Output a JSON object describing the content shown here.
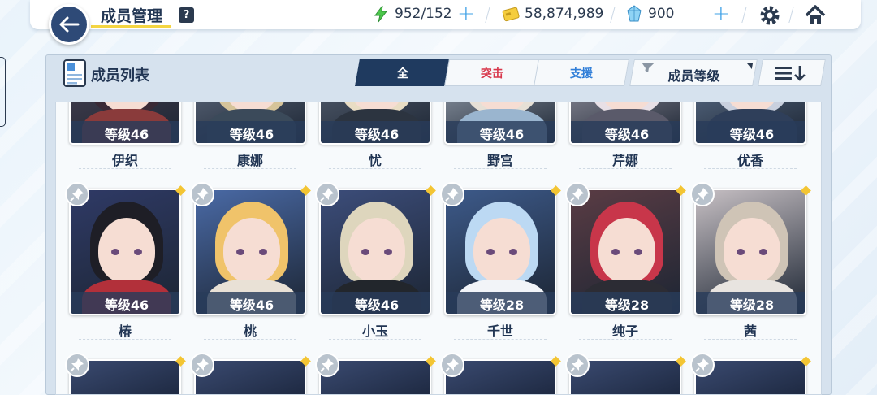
{
  "header": {
    "title": "成员管理",
    "help_label": "?",
    "resources": [
      {
        "icon": "lightning-icon",
        "value": "952/152"
      },
      {
        "icon": "credit-card-icon",
        "value": "58,874,989"
      },
      {
        "icon": "crystal-icon",
        "value": "900"
      }
    ]
  },
  "panel": {
    "title": "成员列表",
    "tabs": [
      {
        "label": "全",
        "active": true
      },
      {
        "label": "突击",
        "active": false
      },
      {
        "label": "支援",
        "active": false
      }
    ],
    "sort_label": "成员等级",
    "order_icon": "sort-descending-icon"
  },
  "members": [
    {
      "name": "伊织",
      "level": "等级46",
      "row": 0
    },
    {
      "name": "康娜",
      "level": "等级46",
      "row": 0
    },
    {
      "name": "忧",
      "level": "等级46",
      "row": 0
    },
    {
      "name": "野宫",
      "level": "等级46",
      "row": 0
    },
    {
      "name": "芹娜",
      "level": "等级46",
      "row": 0
    },
    {
      "name": "优香",
      "level": "等级46",
      "row": 0
    },
    {
      "name": "椿",
      "level": "等级46",
      "row": 1
    },
    {
      "name": "桃",
      "level": "等级46",
      "row": 1
    },
    {
      "name": "小玉",
      "level": "等级46",
      "row": 1
    },
    {
      "name": "千世",
      "level": "等级28",
      "row": 1
    },
    {
      "name": "纯子",
      "level": "等级28",
      "row": 1
    },
    {
      "name": "茜",
      "level": "等级28",
      "row": 1
    }
  ],
  "colors": {
    "accent_navy": "#1f3a5f",
    "strike_red": "#d8384c",
    "support_blue": "#2f7ed8",
    "highlight_yellow": "#f4d542"
  }
}
